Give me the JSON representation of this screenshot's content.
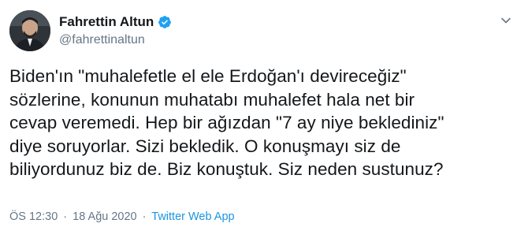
{
  "author": {
    "display_name": "Fahrettin Altun",
    "handle": "@fahrettinaltun",
    "verified": true,
    "avatar": "avatar-photo"
  },
  "tweet": {
    "text_lines": [
      "Biden'ın \"muhalefetle el ele Erdoğan'ı devireceğiz\"",
      "sözlerine, konunun muhatabı muhalefet hala net bir",
      "cevap veremedi. Hep bir ağızdan \"7 ay niye beklediniz\"",
      "diye soruyorlar. Sizi bekledik. O konuşmayı siz de",
      "biliyordunuz biz de. Biz konuştuk. Siz neden sustunuz?"
    ],
    "time": "ÖS 12:30",
    "separator": "·",
    "date": "18 Ağu 2020",
    "source": "Twitter Web App"
  },
  "icons": {
    "verified": "verified-badge-icon",
    "menu": "chevron-down-icon"
  },
  "colors": {
    "text": "#14171a",
    "secondary": "#657786",
    "accent": "#1b95e0"
  }
}
